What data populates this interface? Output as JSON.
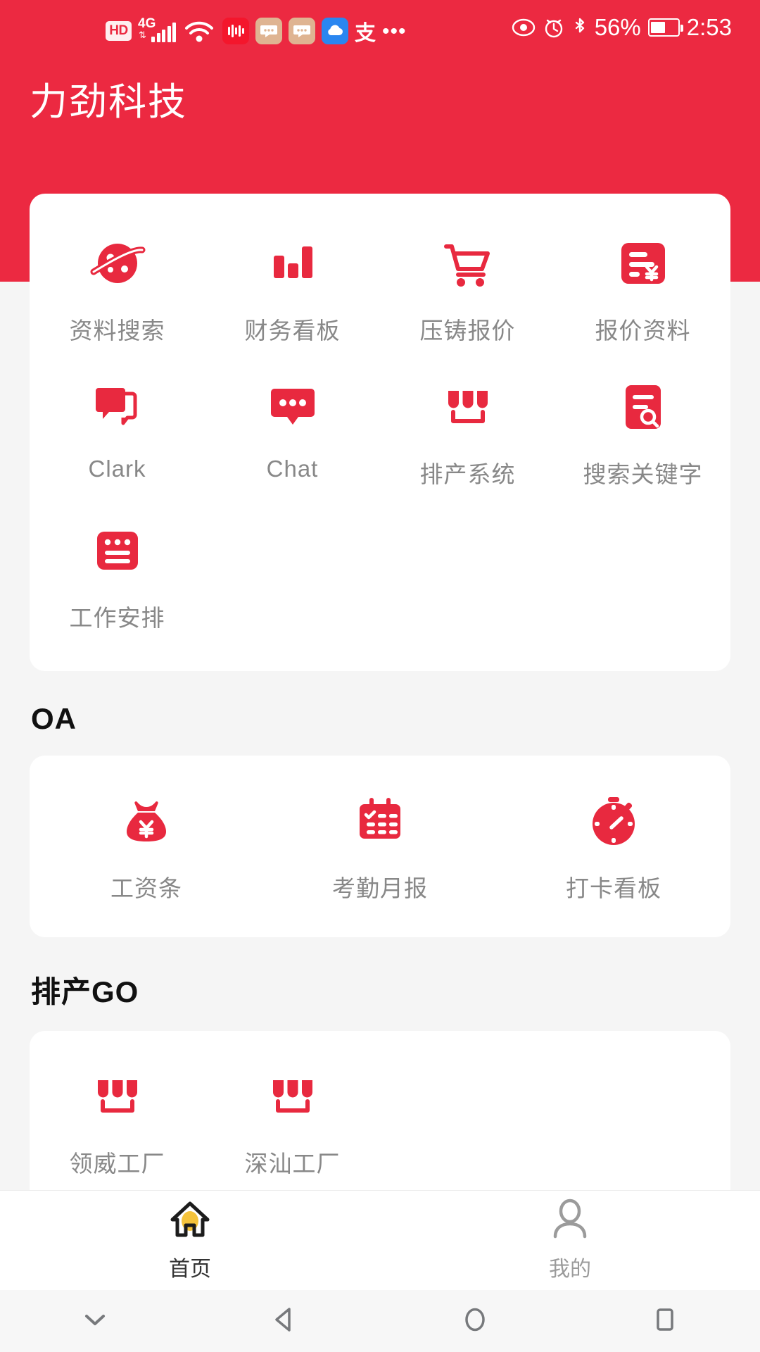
{
  "status_bar": {
    "hd_label": "HD",
    "network_label": "4G",
    "battery_percent": "56%",
    "time": "2:53",
    "icons": [
      "hd-icon",
      "signal-4g-icon",
      "wifi-icon",
      "music-app-icon",
      "chat-app-icon",
      "chat-app-icon-2",
      "cloud-app-icon",
      "alipay-icon",
      "overflow-dots-icon"
    ],
    "right_icons": [
      "eye-care-icon",
      "alarm-icon",
      "bluetooth-icon",
      "battery-icon"
    ]
  },
  "header": {
    "title": "力劲科技",
    "background_color": "#ec2941"
  },
  "sections": [
    {
      "title": "",
      "items": [
        {
          "label": "资料搜索",
          "icon": "planet-icon"
        },
        {
          "label": "财务看板",
          "icon": "bar-chart-icon"
        },
        {
          "label": "压铸报价",
          "icon": "shopping-cart-icon"
        },
        {
          "label": "报价资料",
          "icon": "invoice-yen-icon"
        },
        {
          "label": "Clark",
          "icon": "double-chat-bubble-icon"
        },
        {
          "label": "Chat",
          "icon": "chat-bubble-dots-icon"
        },
        {
          "label": "排产系统",
          "icon": "storefront-icon"
        },
        {
          "label": "搜索关键字",
          "icon": "document-search-icon"
        },
        {
          "label": "工作安排",
          "icon": "note-list-icon"
        }
      ]
    },
    {
      "title": "OA",
      "items": [
        {
          "label": "工资条",
          "icon": "money-bag-yen-icon"
        },
        {
          "label": "考勤月报",
          "icon": "calendar-check-icon"
        },
        {
          "label": "打卡看板",
          "icon": "stopwatch-icon"
        }
      ]
    },
    {
      "title": "排产GO",
      "items": [
        {
          "label": "领威工厂",
          "icon": "storefront-icon"
        },
        {
          "label": "深汕工厂",
          "icon": "storefront-icon"
        }
      ]
    }
  ],
  "tabbar": {
    "tabs": [
      {
        "label": "首页",
        "icon": "home-icon",
        "active": true
      },
      {
        "label": "我的",
        "icon": "person-icon",
        "active": false
      }
    ]
  },
  "system_nav": {
    "buttons": [
      "hide-keyboard-icon",
      "back-icon",
      "home-circle-icon",
      "recents-square-icon"
    ]
  },
  "colors": {
    "brand_red": "#ec2941",
    "icon_red": "#e8293f",
    "label_gray": "#888888",
    "page_bg": "#f5f5f5"
  }
}
